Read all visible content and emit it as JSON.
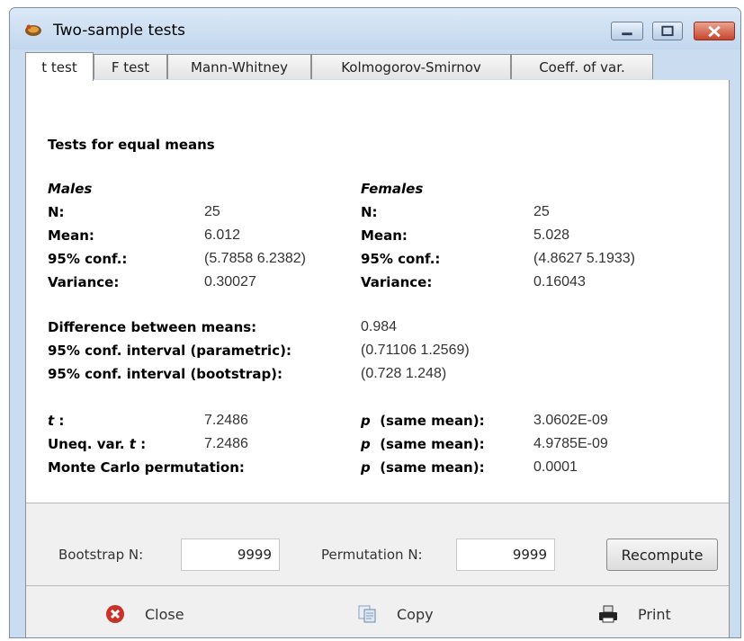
{
  "window": {
    "title": "Two-sample tests"
  },
  "tabs": [
    {
      "label": "t test"
    },
    {
      "label": "F test"
    },
    {
      "label": "Mann-Whitney"
    },
    {
      "label": "Kolmogorov-Smirnov"
    },
    {
      "label": "Coeff. of var."
    }
  ],
  "content": {
    "heading": "Tests for equal means",
    "males": {
      "group": "Males",
      "n_label": "N:",
      "n": "25",
      "mean_label": "Mean:",
      "mean": "6.012",
      "conf_label": "95% conf.:",
      "conf": "(5.7858  6.2382)",
      "var_label": "Variance:",
      "var": "0.30027"
    },
    "females": {
      "group": "Females",
      "n_label": "N:",
      "n": "25",
      "mean_label": "Mean:",
      "mean": "5.028",
      "conf_label": "95% conf.:",
      "conf": "(4.8627  5.1933)",
      "var_label": "Variance:",
      "var": "0.16043"
    },
    "diff": {
      "diff_label": "Difference between means:",
      "diff": "0.984",
      "param_label": "95% conf. interval (parametric):",
      "param": "(0.71106  1.2569)",
      "boot_label": "95% conf. interval (bootstrap):",
      "boot": "(0.728  1.248)"
    },
    "tests": {
      "t_label": "t",
      "t_colon": " :",
      "t": "7.2486",
      "uneq_label": "Uneq. var.",
      "uneq_t": "t",
      "uneq_colon": " :",
      "uneq": "7.2486",
      "mc_label": "Monte Carlo permutation:",
      "p_symbol": "p",
      "p_label": "(same mean):",
      "p1": "3.0602E-09",
      "p2": "4.9785E-09",
      "p3": "0.0001"
    }
  },
  "controls": {
    "bootstrap_label": "Bootstrap N:",
    "bootstrap_value": "9999",
    "permutation_label": "Permutation N:",
    "permutation_value": "9999",
    "recompute": "Recompute"
  },
  "actions": {
    "close": "Close",
    "copy": "Copy",
    "print": "Print"
  }
}
